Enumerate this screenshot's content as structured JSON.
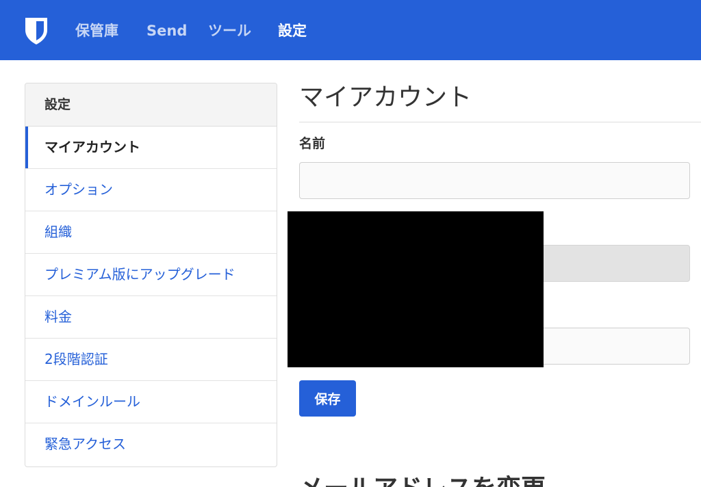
{
  "nav": {
    "logo_icon": "shield-icon",
    "items": [
      {
        "label": "保管庫"
      },
      {
        "label": "Send"
      },
      {
        "label": "ツール"
      },
      {
        "label": "設定",
        "active": true
      }
    ]
  },
  "sidebar": {
    "header": "設定",
    "items": [
      {
        "label": "マイアカウント",
        "active": true
      },
      {
        "label": "オプション"
      },
      {
        "label": "組織"
      },
      {
        "label": "プレミアム版にアップグレード"
      },
      {
        "label": "料金"
      },
      {
        "label": "2段階認証"
      },
      {
        "label": "ドメインルール"
      },
      {
        "label": "緊急アクセス"
      }
    ]
  },
  "main": {
    "title": "マイアカウント",
    "name_label": "名前",
    "name_value": "",
    "field2_value": "",
    "field3_value": "",
    "save_label": "保存",
    "next_section_title": "メールアドレスを変更"
  },
  "colors": {
    "brand": "#2560d8",
    "redaction": "#000000"
  }
}
